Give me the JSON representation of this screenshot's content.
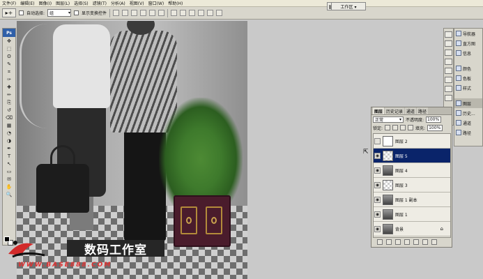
{
  "menu": {
    "items": [
      "文件(F)",
      "编辑(E)",
      "图像(I)",
      "图层(L)",
      "选择(S)",
      "滤镜(T)",
      "分析(A)",
      "视图(V)",
      "窗口(W)",
      "帮助(H)"
    ]
  },
  "options": {
    "tool_icon": "▸+",
    "auto_select_label": "自动选择:",
    "auto_select_value": "组",
    "show_transform_label": "显示变换控件",
    "workspace_label": "工作区 ▾"
  },
  "toolbox": {
    "logo": "Ps",
    "tools": [
      "move-tool",
      "marquee-tool",
      "lasso-tool",
      "quick-select-tool",
      "crop-tool",
      "eyedropper-tool",
      "healing-tool",
      "brush-tool",
      "clone-stamp-tool",
      "history-brush-tool",
      "eraser-tool",
      "gradient-tool",
      "blur-tool",
      "dodge-tool",
      "pen-tool",
      "type-tool",
      "path-select-tool",
      "shape-tool",
      "notes-tool",
      "hand-tool",
      "zoom-tool"
    ],
    "glyphs": [
      "✥",
      "⬚",
      "ʘ",
      "✎",
      "⌗",
      "✑",
      "✚",
      "✏",
      "⎘",
      "↺",
      "⌫",
      "▦",
      "◔",
      "◑",
      "✒",
      "T",
      "↖",
      "▭",
      "✉",
      "✋",
      "🔍"
    ]
  },
  "watermark": {
    "title": "数码工作室",
    "url": "WWW.BASE888.COM"
  },
  "dock": {
    "items": [
      {
        "label": "导航器",
        "icon": "navigator-icon"
      },
      {
        "label": "直方图",
        "icon": "histogram-icon"
      },
      {
        "label": "信息",
        "icon": "info-icon"
      },
      {
        "label": "颜色",
        "icon": "color-icon"
      },
      {
        "label": "色板",
        "icon": "swatches-icon"
      },
      {
        "label": "样式",
        "icon": "styles-icon"
      },
      {
        "label": "图层",
        "icon": "layers-icon"
      },
      {
        "label": "历史...",
        "icon": "history-icon"
      },
      {
        "label": "通道",
        "icon": "channels-icon"
      },
      {
        "label": "路径",
        "icon": "paths-icon"
      }
    ]
  },
  "layers_panel": {
    "tabs": [
      "图层",
      "历史记录",
      "通道",
      "路径"
    ],
    "blend_mode": "正常",
    "opacity_label": "不透明度:",
    "opacity_value": "100%",
    "lock_label": "锁定:",
    "fill_label": "填充:",
    "fill_value": "100%",
    "layers": [
      {
        "name": "图层 2",
        "visible": false,
        "thumb": "blank"
      },
      {
        "name": "图层 5",
        "visible": true,
        "thumb": "transparent"
      },
      {
        "name": "图层 4",
        "visible": true,
        "thumb": "photo"
      },
      {
        "name": "图层 3",
        "visible": true,
        "thumb": "transparent"
      },
      {
        "name": "图层 1 副本",
        "visible": true,
        "thumb": "photo"
      },
      {
        "name": "图层 1",
        "visible": true,
        "thumb": "photo"
      },
      {
        "name": "背景",
        "visible": true,
        "thumb": "photo"
      }
    ],
    "selected_index": 1,
    "footer_buttons": [
      "link-icon",
      "fx-icon",
      "mask-icon",
      "adjustment-icon",
      "group-icon",
      "new-layer-icon",
      "delete-icon"
    ]
  }
}
